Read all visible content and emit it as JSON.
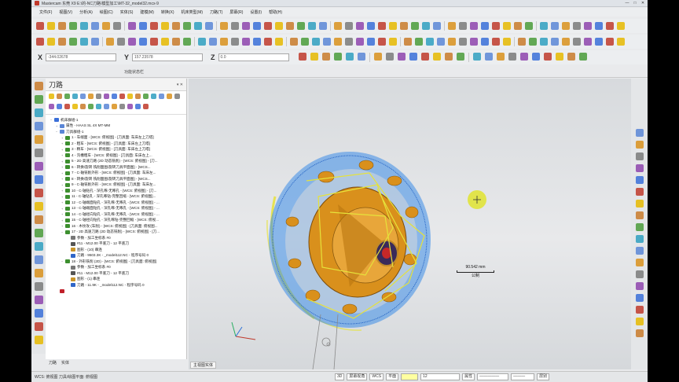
{
  "window": {
    "title": "Mastercam 东莞 X9  E:\\的-NC刀路\\模型加工\\MT-32_model32.mcx-9",
    "min": "—",
    "max": "□",
    "close": "✕"
  },
  "menu": [
    "文件(F)",
    "视图(V)",
    "分析(A)",
    "绘图(C)",
    "实体(S)",
    "建模(M)",
    "转换(X)",
    "机床类型(M)",
    "刀路(T)",
    "屏幕(R)",
    "设置(I)",
    "帮助(H)"
  ],
  "coords": {
    "x_label": "X",
    "x_value": "-344.02678",
    "y_label": "Y",
    "y_value": "157.23578",
    "z_label": "Z",
    "z_value": "0.0"
  },
  "ribbon_group_label": "功能状态栏",
  "panel": {
    "title": "刀路",
    "pin": "▾ ✕"
  },
  "tree": [
    {
      "text": "机床群组-1",
      "level": 0,
      "color": "#3a6fd8",
      "exp": "−"
    },
    {
      "text": "属性 - HAAS SL 4X MT-MM",
      "level": 1,
      "color": "#5a86d6",
      "exp": "+"
    },
    {
      "text": "刀具群组-1",
      "level": 1,
      "color": "#5a86d6",
      "exp": "−"
    },
    {
      "text": "1 - 车端面 - [WCS: 俯视图] - [刀具面: 车床左上刀塔]",
      "level": 2,
      "color": "#3d8f2f",
      "exp": "+"
    },
    {
      "text": "2 - 粗车 - [WCS: 俯视图] - [刀具面: 车床左上刀塔]",
      "level": 2,
      "color": "#3d8f2f",
      "exp": "+"
    },
    {
      "text": "3 - 精车 - [WCS: 俯视图] - [刀具面: 车床左上刀塔]",
      "level": 2,
      "color": "#3d8f2f",
      "exp": "+"
    },
    {
      "text": "4 - 沟槽粗车 - [WCS: 俯视图] - [刀具面: 车床左上...",
      "level": 2,
      "color": "#3d8f2f",
      "exp": "+"
    },
    {
      "text": "5 - 2D 高速刀路 (2D 动态铣削) - [WCS: 俯视图] - [刀...",
      "level": 2,
      "color": "#3d8f2f",
      "exp": "+"
    },
    {
      "text": "6 - 转换/旋转 铣削面图/旋转刀具平面图] - [WCS...",
      "level": 2,
      "color": "#3d8f2f",
      "exp": "+"
    },
    {
      "text": "7 - C-轴铣削外形 - [WCS: 俯视图] - [刀具面: 车床左...",
      "level": 2,
      "color": "#3d8f2f",
      "exp": "+"
    },
    {
      "text": "8 - 转换/旋转 铣削面图/旋转刀具平面图] - [WCS...",
      "level": 2,
      "color": "#3d8f2f",
      "exp": "+"
    },
    {
      "text": "9 - C-轴铣削外形 - [WCS: 俯视图] - [刀具面: 车床左...",
      "level": 2,
      "color": "#3d8f2f",
      "exp": "+"
    },
    {
      "text": "10 - C-轴钻孔 - 深孔啄-无啄孔 - [WCS: 俯视图] - [刀...",
      "level": 2,
      "color": "#3d8f2f",
      "exp": "+"
    },
    {
      "text": "11 - C-轴钻孔 - 深孔啄钻-完整回缩 - [WCS: 俯视图]...",
      "level": 2,
      "color": "#3d8f2f",
      "exp": "+"
    },
    {
      "text": "12 - C-轴端面钻孔 - 深孔啄-无啄孔 - [WCS: 俯视图] - ...",
      "level": 2,
      "color": "#3d8f2f",
      "exp": "+"
    },
    {
      "text": "13 - C-轴端面钻孔 - 深孔啄-无啄孔 - [WCS: 俯视图] - ...",
      "level": 2,
      "color": "#3d8f2f",
      "exp": "+"
    },
    {
      "text": "14 - C-轴径向钻孔 - 深孔啄-无啄孔 - [WCS: 俯视图] - ...",
      "level": 2,
      "color": "#3d8f2f",
      "exp": "+"
    },
    {
      "text": "15 - C-轴径向钻孔 - 深孔啄钻-完整回缩 - [WCS: 俯视...",
      "level": 2,
      "color": "#3d8f2f",
      "exp": "+"
    },
    {
      "text": "16 - 木纹攻 (车削) - [WCS: 俯视图] - [刀具面: 俯视图...",
      "level": 2,
      "color": "#3d8f2f",
      "exp": "+"
    },
    {
      "text": "17 - 2D 高速刀路 (2D 动态铣削) - [WCS: 俯视图] - [刀...",
      "level": 2,
      "color": "#3d8f2f",
      "exp": "−"
    },
    {
      "text": "参数 - 加工坐标系 #0",
      "level": 3,
      "color": "#777",
      "exp": ""
    },
    {
      "text": "#11 - M12.00 平底刀 - 12 平底刀",
      "level": 3,
      "color": "#555",
      "exp": ""
    },
    {
      "text": "图形 - (10) 串连",
      "level": 3,
      "color": "#c9952a",
      "exp": ""
    },
    {
      "text": "刀路 - 9503.3K - _model112.NC - 程序号码 0",
      "level": 3,
      "color": "#2f66c9",
      "exp": ""
    },
    {
      "text": "18 - 外形铣削 (2D) - [WCS: 俯视图] - [刀具面: 俯视图]",
      "level": 2,
      "color": "#3d8f2f",
      "exp": "−"
    },
    {
      "text": "参数 - 加工坐标系 #0",
      "level": 3,
      "color": "#777",
      "exp": ""
    },
    {
      "text": "#11 - M12.00 平底刀 - 12 平底刀",
      "level": 3,
      "color": "#555",
      "exp": ""
    },
    {
      "text": "图形 - (1) 串连",
      "level": 3,
      "color": "#c9952a",
      "exp": ""
    },
    {
      "text": "刀路 - 11.9K - _model112.NC - 程序号码 0",
      "level": 3,
      "color": "#2f66c9",
      "exp": ""
    },
    {
      "text": "",
      "level": 1,
      "color": "#c0202a",
      "exp": ""
    }
  ],
  "bottom_tabs": [
    "刀路",
    "实体"
  ],
  "view_tab": "主视图实体",
  "scale": {
    "value": "90.542 mm",
    "unit": "公制"
  },
  "status": {
    "left": "WCS: 俯视图  刀具/绘图平面: 俯视图",
    "mode": "3D",
    "view": "屏幕视角",
    "wcs": "WCS",
    "plane": "平面",
    "level": "12",
    "attr": "属性",
    "layer": "层别"
  },
  "colors": {
    "accent": "#2c73c4",
    "part_gold": "#d9901c",
    "toolpath_yellow": "#e6e23a",
    "toolpath_blue": "#2e7fe0"
  },
  "icons": [
    "new-file-icon",
    "open-icon",
    "save-icon",
    "print-icon",
    "undo-icon",
    "redo-icon",
    "zoom-icon",
    "rotate-icon",
    "solid-icon",
    "line-icon",
    "circle-icon",
    "arc-icon",
    "point-icon",
    "trim-icon",
    "layer-icon",
    "help-icon",
    "cursor-crosshair-icon"
  ]
}
